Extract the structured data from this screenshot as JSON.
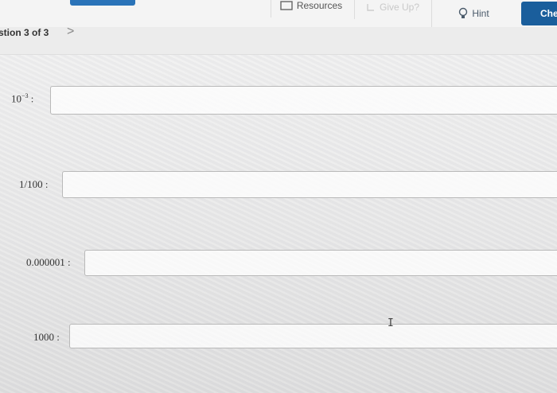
{
  "toolbar": {
    "resources_label": "Resources",
    "give_up_label": "Give Up?",
    "hint_label": "Hint",
    "check_label": "Che"
  },
  "question_nav": {
    "label": "stion 3 of 3",
    "next_glyph": ">"
  },
  "rows": [
    {
      "base": "10",
      "exponent": "−3",
      "separator": ":",
      "value": "",
      "placeholder": ""
    },
    {
      "label": "1/100",
      "separator": ":",
      "value": "",
      "placeholder": ""
    },
    {
      "label": "0.000001",
      "separator": ":",
      "value": "",
      "placeholder": ""
    },
    {
      "label": "1000",
      "separator": ":",
      "value": "",
      "placeholder": ""
    }
  ],
  "colors": {
    "check_button": "#1a5e9c",
    "top_tab": "#2a73b8",
    "hint_text": "#4a5a6a"
  },
  "cursor_glyph": "I"
}
